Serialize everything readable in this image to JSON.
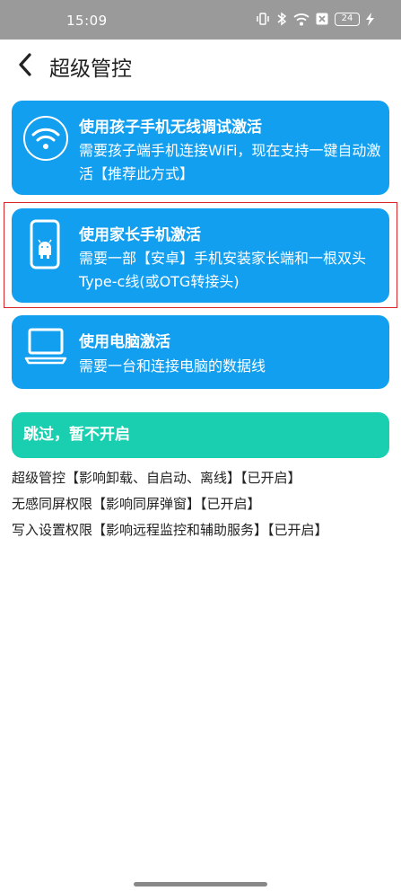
{
  "status_bar": {
    "time": "15:09",
    "battery": "24",
    "icons": [
      "vibrate-icon",
      "bluetooth-icon",
      "wifi-icon",
      "sim-off-icon",
      "battery-icon",
      "charging-icon"
    ]
  },
  "header": {
    "title": "超级管控",
    "back_icon": "chevron-left-icon"
  },
  "options": [
    {
      "title": "使用孩子手机无线调试激活",
      "desc": "需要孩子端手机连接WiFi，现在支持一键自动激活【推荐此方式】",
      "icon": "wifi-icon"
    },
    {
      "title": "使用家长手机激活",
      "desc": "需要一部【安卓】手机安装家长端和一根双头Type-c线(或OTG转接头)",
      "icon": "android-phone-icon"
    },
    {
      "title": "使用电脑激活",
      "desc": "需要一台和连接电脑的数据线",
      "icon": "laptop-icon"
    }
  ],
  "skip_button": {
    "label": "跳过，暂不开启"
  },
  "permissions": [
    "超级管控【影响卸载、自启动、离线】【已开启】",
    "无感同屏权限【影响同屏弹窗】【已开启】",
    "写入设置权限【影响远程监控和辅助服务】【已开启】"
  ],
  "colors": {
    "card_blue": "#129ff0",
    "skip_teal": "#19cfb0",
    "highlight_red": "#d9262b",
    "status_bar_gray": "#9a9a9a"
  }
}
